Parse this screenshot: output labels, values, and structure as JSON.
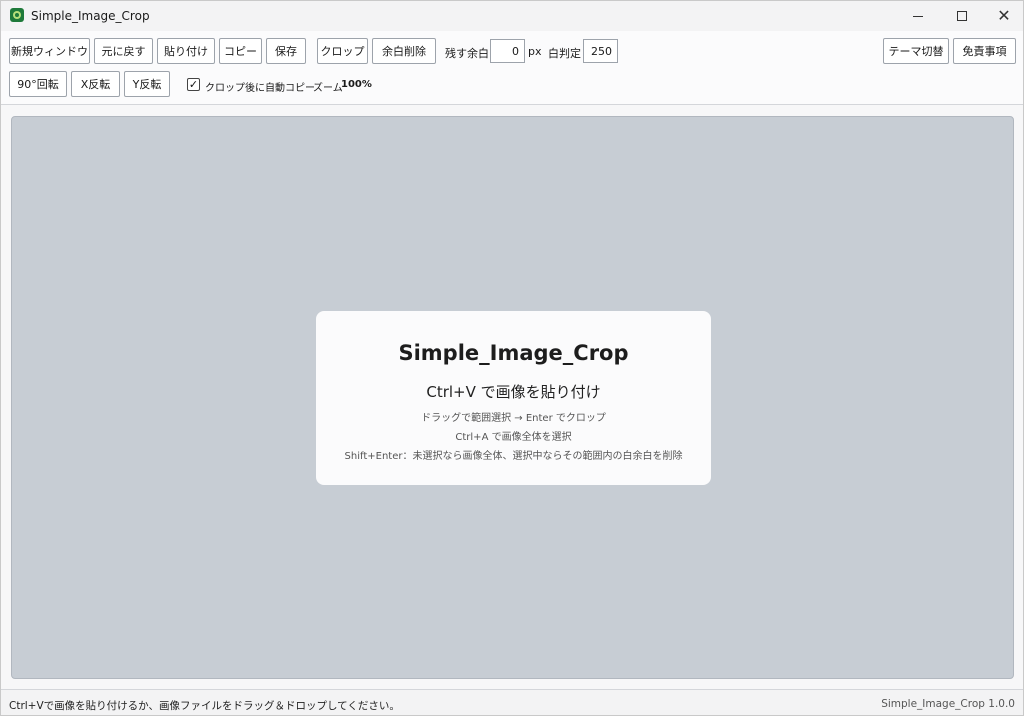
{
  "window": {
    "title": "Simple_Image_Crop",
    "minimize_icon": "minimize-icon",
    "maximize_icon": "maximize-icon",
    "close_icon": "close-icon",
    "close_glyph": "✕"
  },
  "toolbar": {
    "row1": {
      "new_window": "新規ウィンドウ",
      "undo": "元に戻す",
      "paste": "貼り付け",
      "copy": "コピー",
      "save": "保存",
      "crop": "クロップ",
      "trim_margin": "余白削除",
      "keep_margin_label": "残す余白",
      "keep_margin_value": "0",
      "px_unit": "px",
      "white_threshold_label": "白判定",
      "white_threshold_value": "250",
      "theme_toggle": "テーマ切替",
      "disclaimer": "免責事項"
    },
    "row2": {
      "rotate90": "90°回転",
      "flip_x": "X反転",
      "flip_y": "Y反転",
      "auto_copy_label": "クロップ後に自動コピー",
      "auto_copy_checked": true,
      "check_glyph": "✓",
      "zoom_label": "ズーム",
      "zoom_value": "100%"
    }
  },
  "canvas": {
    "card": {
      "title": "Simple_Image_Crop",
      "subtitle": "Ctrl+V で画像を貼り付け",
      "line1": "ドラッグで範囲選択 → Enter でクロップ",
      "line2": "Ctrl+A で画像全体を選択",
      "line3": "Shift+Enter：未選択なら画像全体、選択中ならその範囲内の白余白を削除"
    }
  },
  "status": {
    "message": "Ctrl+Vで画像を貼り付けるか、画像ファイルをドラッグ＆ドロップしてください。",
    "version": "Simple_Image_Crop 1.0.0"
  },
  "colors": {
    "canvas_bg": "#c7cdd4",
    "card_bg": "#fbfbfc",
    "window_bg": "#f7f7f8"
  }
}
